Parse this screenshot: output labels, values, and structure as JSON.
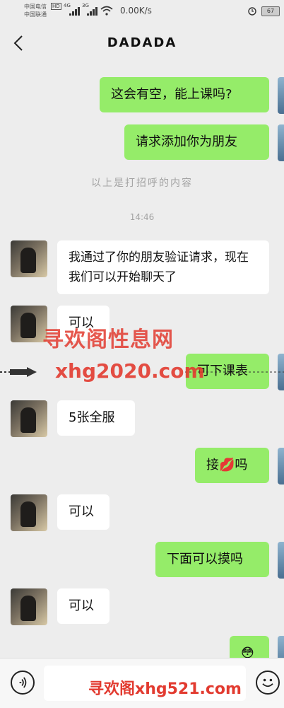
{
  "status_bar": {
    "carrier1": "中国电信",
    "carrier2": "中国联通",
    "hd": "HD",
    "net1": "4G",
    "net2": "3G",
    "speed": "0.00K/s",
    "battery": "67"
  },
  "header": {
    "title": "DADADA"
  },
  "messages": [
    {
      "side": "right",
      "text": "这会有空，能上课吗?"
    },
    {
      "side": "right",
      "text": "请求添加你为朋友"
    },
    {
      "side": "system",
      "text": "以上是打招呼的内容"
    },
    {
      "side": "time",
      "text": "14:46"
    },
    {
      "side": "left",
      "text": "我通过了你的朋友验证请求，现在我们可以开始聊天了"
    },
    {
      "side": "left",
      "text": "可以"
    },
    {
      "side": "right",
      "text": "可下课表"
    },
    {
      "side": "left",
      "text": "5张全服"
    },
    {
      "side": "right",
      "text": "接💋吗"
    },
    {
      "side": "left",
      "text": "可以"
    },
    {
      "side": "right",
      "text": "下面可以摸吗"
    },
    {
      "side": "left",
      "text": "可以"
    },
    {
      "side": "right",
      "text": "😳"
    }
  ],
  "watermarks": {
    "top": "寻欢阁性息网",
    "middle": "xhg2020.com",
    "bottom": "寻欢阁xhg521.com"
  },
  "input": {
    "placeholder": ""
  },
  "icons": {
    "back": "chevron-left-icon",
    "voice": "voice-icon",
    "emoji": "emoji-icon",
    "alarm": "alarm-icon",
    "wifi": "wifi-icon",
    "signal": "signal-icon",
    "arrow": "arrow-right-icon"
  },
  "colors": {
    "right_bubble": "#95ec69",
    "left_bubble": "#ffffff",
    "background": "#ededed",
    "watermark": "#e23b30"
  }
}
